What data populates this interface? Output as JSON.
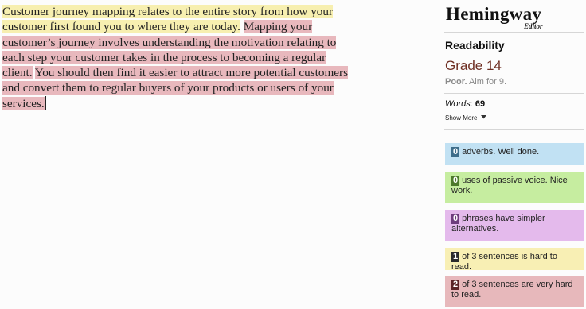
{
  "editor": {
    "sentences": [
      {
        "text": "Customer journey mapping relates to the entire story from how your customer first found you to where they are today.",
        "level": "hard"
      },
      {
        "text": "Mapping your customer’s journey involves understanding the motivation relating to each step your customer takes in the process to becoming a regular client.",
        "level": "very-hard"
      },
      {
        "text": "You should then find it easier to attract more potential customers and convert them to regular buyers of your products or users of your services.",
        "level": "very-hard"
      }
    ]
  },
  "logo": {
    "title": "Hemingway",
    "subtitle": "Editor"
  },
  "readability": {
    "heading": "Readability",
    "grade": "Grade 14",
    "verdict": "Poor.",
    "aim": "Aim for 9."
  },
  "stats": {
    "words_label": "Words",
    "words_value": "69",
    "show_more": "Show More"
  },
  "cards": {
    "adverbs": {
      "count": "0",
      "text": "adverbs. Well done."
    },
    "passive": {
      "count": "0",
      "text": "uses of passive voice. Nice work."
    },
    "phrases": {
      "count": "0",
      "text": "phrases have simpler alternatives."
    },
    "hard": {
      "count": "1",
      "text": "of 3 sentences is hard to read."
    },
    "very_hard": {
      "count": "2",
      "text": "of 3 sentences are very hard to read."
    }
  },
  "colors": {
    "hard_highlight": "#f7efb0",
    "very_hard_highlight": "#e8b8bd",
    "grade_text": "#6e2e22"
  }
}
